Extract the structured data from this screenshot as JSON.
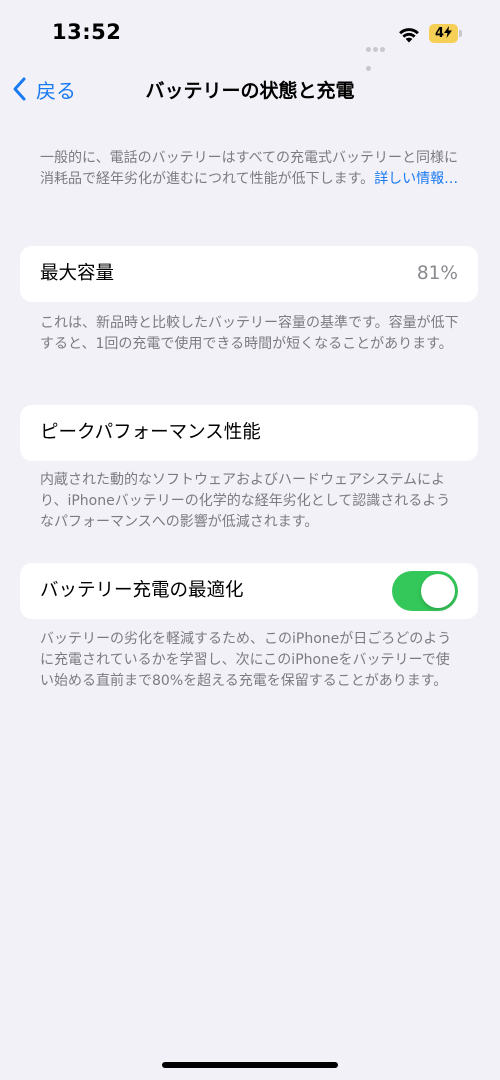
{
  "status_bar": {
    "time": "13:52",
    "battery_level": "4",
    "wifi_icon": "wifi-icon",
    "battery_icon": "battery-icon",
    "battery_color": "#f6cf57"
  },
  "nav": {
    "back_label": "戻る",
    "back_icon": "chevron-left-icon",
    "title": "バッテリーの状態と充電",
    "accent_color": "#1a7af2"
  },
  "intro": {
    "text": "一般的に、電話のバッテリーはすべての充電式バッテリーと同様に消耗品で経年劣化が進むにつれて性能が低下します。",
    "link": "詳しい情報…"
  },
  "max_capacity": {
    "label": "最大容量",
    "value": "81%",
    "footnote": "これは、新品時と比較したバッテリー容量の基準です。容量が低下すると、1回の充電で使用できる時間が短くなることがあります。"
  },
  "peak_performance": {
    "label": "ピークパフォーマンス性能",
    "footnote": "内蔵された動的なソフトウェアおよびハードウェアシステムにより、iPhoneバッテリーの化学的な経年劣化として認識されるようなパフォーマンスへの影響が低減されます。"
  },
  "optimized_charging": {
    "label": "バッテリー充電の最適化",
    "enabled": true,
    "toggle_color": "#34c759",
    "footnote": "バッテリーの劣化を軽減するため、このiPhoneが日ごろどのように充電されているかを学習し、次にこのiPhoneをバッテリーで使い始める直前まで80%を超える充電を保留することがあります。"
  }
}
